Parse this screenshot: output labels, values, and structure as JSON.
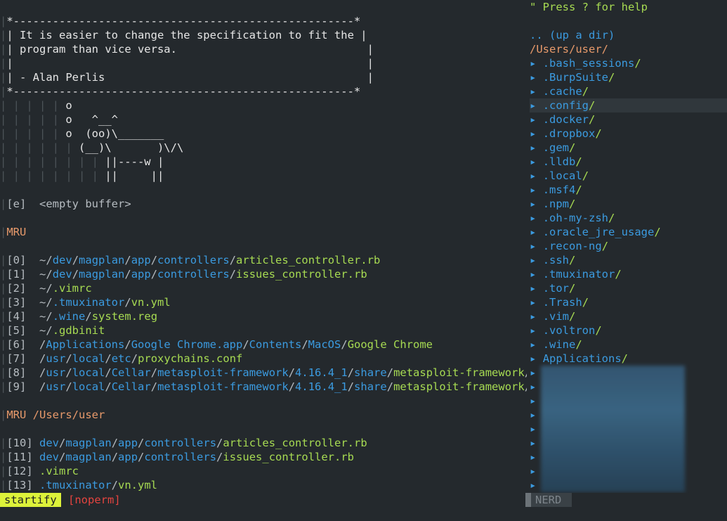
{
  "startify": {
    "quote_lines": [
      "*----------------------------------------------------*",
      "| It is easier to change the specification to fit the |",
      "| program than vice versa.                             |",
      "|                                                      |",
      "| - Alan Perlis                                        |",
      "*----------------------------------------------------*"
    ],
    "cow_lines": [
      "o",
      "o   ^__^",
      "o  (oo)\\_______",
      "(__)\\       )\\/\\",
      "||----w |",
      "||     ||"
    ],
    "empty_buffer": {
      "key": "[e]",
      "label": "<empty buffer>"
    },
    "mru_header": "MRU",
    "mru_items": [
      {
        "key": "[0]",
        "parts": [
          "~/",
          "dev",
          "/",
          "magplan",
          "/",
          "app",
          "/",
          "controllers",
          "/",
          "articles_controller.rb"
        ]
      },
      {
        "key": "[1]",
        "parts": [
          "~/",
          "dev",
          "/",
          "magplan",
          "/",
          "app",
          "/",
          "controllers",
          "/",
          "issues_controller.rb"
        ]
      },
      {
        "key": "[2]",
        "parts": [
          "~/",
          ".vimrc"
        ]
      },
      {
        "key": "[3]",
        "parts": [
          "~/",
          ".tmuxinator",
          "/",
          "vn.yml"
        ]
      },
      {
        "key": "[4]",
        "parts": [
          "~/",
          ".wine",
          "/",
          "system.reg"
        ]
      },
      {
        "key": "[5]",
        "parts": [
          "~/",
          ".gdbinit"
        ]
      },
      {
        "key": "[6]",
        "parts": [
          "/",
          "Applications",
          "/",
          "Google Chrome.app",
          "/",
          "Contents",
          "/",
          "MacOS",
          "/",
          "Google Chrome"
        ]
      },
      {
        "key": "[7]",
        "parts": [
          "/",
          "usr",
          "/",
          "local",
          "/",
          "etc",
          "/",
          "proxychains.conf"
        ]
      },
      {
        "key": "[8]",
        "parts": [
          "/",
          "usr",
          "/",
          "local",
          "/",
          "Cellar",
          "/",
          "metasploit-framework",
          "/",
          "4.16.4_1",
          "/",
          "share",
          "/",
          "metasploit-framework",
          "/"
        ]
      },
      {
        "key": "[9]",
        "parts": [
          "/",
          "usr",
          "/",
          "local",
          "/",
          "Cellar",
          "/",
          "metasploit-framework",
          "/",
          "4.16.4_1",
          "/",
          "share",
          "/",
          "metasploit-framework",
          "/"
        ]
      }
    ],
    "mru_dir_header": "MRU /Users/user",
    "mru_dir_items": [
      {
        "key": "[10]",
        "parts": [
          "dev",
          "/",
          "magplan",
          "/",
          "app",
          "/",
          "controllers",
          "/",
          "articles_controller.rb"
        ]
      },
      {
        "key": "[11]",
        "parts": [
          "dev",
          "/",
          "magplan",
          "/",
          "app",
          "/",
          "controllers",
          "/",
          "issues_controller.rb"
        ]
      },
      {
        "key": "[12]",
        "parts": [
          ".vimrc"
        ]
      },
      {
        "key": "[13]",
        "parts": [
          ".tmuxinator",
          "/",
          "vn.yml"
        ]
      }
    ]
  },
  "nerdtree": {
    "help": "\" Press ? for help",
    "up_dir": ".. (up a dir)",
    "root": "/Users/user/",
    "arrow": "▸",
    "dirs": [
      ".bash_sessions",
      ".BurpSuite",
      ".cache",
      ".config",
      ".docker",
      ".dropbox",
      ".gem",
      ".lldb",
      ".local",
      ".msf4",
      ".npm",
      ".oh-my-zsh",
      ".oracle_jre_usage",
      ".recon-ng",
      ".ssh",
      ".tmuxinator",
      ".tor",
      ".Trash",
      ".vim",
      ".voltron",
      ".wine",
      "Applications"
    ],
    "highlighted_index": 3,
    "blurred_rows": 9
  },
  "statusline": {
    "mode": "startify",
    "flag": "[noperm]",
    "nerd": "NERD"
  },
  "colors": {
    "background": "#24292d",
    "accent_blue": "#3b9be0",
    "accent_green": "#a7db52",
    "header_orange": "#e89a6b",
    "mode_yellow": "#ddf23a",
    "error_red": "#e5443f"
  }
}
